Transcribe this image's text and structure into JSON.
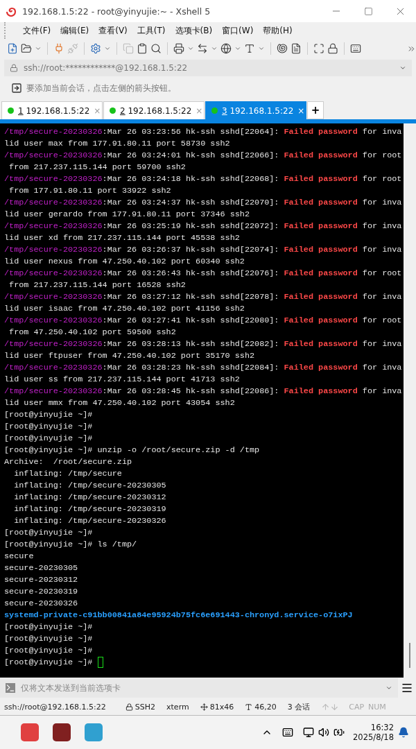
{
  "window": {
    "title": "192.168.1.5:22 - root@yinyujie:~ - Xshell 5"
  },
  "menu": [
    {
      "label": "文件(F)"
    },
    {
      "label": "编辑(E)"
    },
    {
      "label": "查看(V)"
    },
    {
      "label": "工具(T)"
    },
    {
      "label": "选项卡(B)"
    },
    {
      "label": "窗口(W)"
    },
    {
      "label": "帮助(H)"
    }
  ],
  "address_bar": {
    "value": "ssh://root:************@192.168.1.5:22"
  },
  "hint_bar": {
    "text": "要添加当前会话，点击左侧的箭头按钮。"
  },
  "tabs": [
    {
      "number": "1",
      "label": "192.168.1.5:22",
      "selected": false,
      "close": "×"
    },
    {
      "number": "2",
      "label": "192.168.1.5:22",
      "selected": false,
      "close": "×"
    },
    {
      "number": "3",
      "label": "192.168.1.5:22",
      "selected": true,
      "close": "×"
    }
  ],
  "new_tab": "+",
  "terminal": {
    "lines": [
      [
        {
          "kind": "path",
          "text": "/tmp/secure-20230326"
        },
        {
          "kind": "plain",
          "text": ":Mar 26 03:23:56 hk-ssh sshd[22064]: "
        },
        {
          "kind": "alert",
          "text": "Failed password"
        },
        {
          "kind": "plain",
          "text": " for inva"
        }
      ],
      [
        {
          "kind": "plain",
          "text": "lid user max from 177.91.80.11 port 58730 ssh2"
        }
      ],
      [
        {
          "kind": "path",
          "text": "/tmp/secure-20230326"
        },
        {
          "kind": "plain",
          "text": ":Mar 26 03:24:01 hk-ssh sshd[22066]: "
        },
        {
          "kind": "alert",
          "text": "Failed password"
        },
        {
          "kind": "plain",
          "text": " for root"
        }
      ],
      [
        {
          "kind": "plain",
          "text": " from 217.237.115.144 port 59700 ssh2"
        }
      ],
      [
        {
          "kind": "path",
          "text": "/tmp/secure-20230326"
        },
        {
          "kind": "plain",
          "text": ":Mar 26 03:24:18 hk-ssh sshd[22068]: "
        },
        {
          "kind": "alert",
          "text": "Failed password"
        },
        {
          "kind": "plain",
          "text": " for root"
        }
      ],
      [
        {
          "kind": "plain",
          "text": " from 177.91.80.11 port 33922 ssh2"
        }
      ],
      [
        {
          "kind": "path",
          "text": "/tmp/secure-20230326"
        },
        {
          "kind": "plain",
          "text": ":Mar 26 03:24:37 hk-ssh sshd[22070]: "
        },
        {
          "kind": "alert",
          "text": "Failed password"
        },
        {
          "kind": "plain",
          "text": " for inva"
        }
      ],
      [
        {
          "kind": "plain",
          "text": "lid user gerardo from 177.91.80.11 port 37346 ssh2"
        }
      ],
      [
        {
          "kind": "path",
          "text": "/tmp/secure-20230326"
        },
        {
          "kind": "plain",
          "text": ":Mar 26 03:25:19 hk-ssh sshd[22072]: "
        },
        {
          "kind": "alert",
          "text": "Failed password"
        },
        {
          "kind": "plain",
          "text": " for inva"
        }
      ],
      [
        {
          "kind": "plain",
          "text": "lid user xd from 217.237.115.144 port 45538 ssh2"
        }
      ],
      [
        {
          "kind": "path",
          "text": "/tmp/secure-20230326"
        },
        {
          "kind": "plain",
          "text": ":Mar 26 03:26:37 hk-ssh sshd[22074]: "
        },
        {
          "kind": "alert",
          "text": "Failed password"
        },
        {
          "kind": "plain",
          "text": " for inva"
        }
      ],
      [
        {
          "kind": "plain",
          "text": "lid user nexus from 47.250.40.102 port 60340 ssh2"
        }
      ],
      [
        {
          "kind": "path",
          "text": "/tmp/secure-20230326"
        },
        {
          "kind": "plain",
          "text": ":Mar 26 03:26:43 hk-ssh sshd[22076]: "
        },
        {
          "kind": "alert",
          "text": "Failed password"
        },
        {
          "kind": "plain",
          "text": " for root"
        }
      ],
      [
        {
          "kind": "plain",
          "text": " from 217.237.115.144 port 16528 ssh2"
        }
      ],
      [
        {
          "kind": "path",
          "text": "/tmp/secure-20230326"
        },
        {
          "kind": "plain",
          "text": ":Mar 26 03:27:12 hk-ssh sshd[22078]: "
        },
        {
          "kind": "alert",
          "text": "Failed password"
        },
        {
          "kind": "plain",
          "text": " for inva"
        }
      ],
      [
        {
          "kind": "plain",
          "text": "lid user isaac from 47.250.40.102 port 41156 ssh2"
        }
      ],
      [
        {
          "kind": "path",
          "text": "/tmp/secure-20230326"
        },
        {
          "kind": "plain",
          "text": ":Mar 26 03:27:41 hk-ssh sshd[22080]: "
        },
        {
          "kind": "alert",
          "text": "Failed password"
        },
        {
          "kind": "plain",
          "text": " for root"
        }
      ],
      [
        {
          "kind": "plain",
          "text": " from 47.250.40.102 port 59500 ssh2"
        }
      ],
      [
        {
          "kind": "path",
          "text": "/tmp/secure-20230326"
        },
        {
          "kind": "plain",
          "text": ":Mar 26 03:28:13 hk-ssh sshd[22082]: "
        },
        {
          "kind": "alert",
          "text": "Failed password"
        },
        {
          "kind": "plain",
          "text": " for inva"
        }
      ],
      [
        {
          "kind": "plain",
          "text": "lid user ftpuser from 47.250.40.102 port 35170 ssh2"
        }
      ],
      [
        {
          "kind": "path",
          "text": "/tmp/secure-20230326"
        },
        {
          "kind": "plain",
          "text": ":Mar 26 03:28:23 hk-ssh sshd[22084]: "
        },
        {
          "kind": "alert",
          "text": "Failed password"
        },
        {
          "kind": "plain",
          "text": " for inva"
        }
      ],
      [
        {
          "kind": "plain",
          "text": "lid user ss from 217.237.115.144 port 41713 ssh2"
        }
      ],
      [
        {
          "kind": "path",
          "text": "/tmp/secure-20230326"
        },
        {
          "kind": "plain",
          "text": ":Mar 26 03:28:45 hk-ssh sshd[22086]: "
        },
        {
          "kind": "alert",
          "text": "Failed password"
        },
        {
          "kind": "plain",
          "text": " for inva"
        }
      ],
      [
        {
          "kind": "plain",
          "text": "lid user mmx from 47.250.40.102 port 43054 ssh2"
        }
      ],
      [
        {
          "kind": "plain",
          "text": "[root@yinyujie ~]#"
        }
      ],
      [
        {
          "kind": "plain",
          "text": "[root@yinyujie ~]#"
        }
      ],
      [
        {
          "kind": "plain",
          "text": "[root@yinyujie ~]#"
        }
      ],
      [
        {
          "kind": "plain",
          "text": "[root@yinyujie ~]# unzip -o /root/secure.zip -d /tmp"
        }
      ],
      [
        {
          "kind": "plain",
          "text": "Archive:  /root/secure.zip"
        }
      ],
      [
        {
          "kind": "plain",
          "text": "  inflating: /tmp/secure"
        }
      ],
      [
        {
          "kind": "plain",
          "text": "  inflating: /tmp/secure-20230305"
        }
      ],
      [
        {
          "kind": "plain",
          "text": "  inflating: /tmp/secure-20230312"
        }
      ],
      [
        {
          "kind": "plain",
          "text": "  inflating: /tmp/secure-20230319"
        }
      ],
      [
        {
          "kind": "plain",
          "text": "  inflating: /tmp/secure-20230326"
        }
      ],
      [
        {
          "kind": "plain",
          "text": "[root@yinyujie ~]#"
        }
      ],
      [
        {
          "kind": "plain",
          "text": "[root@yinyujie ~]# ls /tmp/"
        }
      ],
      [
        {
          "kind": "plain",
          "text": "secure"
        }
      ],
      [
        {
          "kind": "plain",
          "text": "secure-20230305"
        }
      ],
      [
        {
          "kind": "plain",
          "text": "secure-20230312"
        }
      ],
      [
        {
          "kind": "plain",
          "text": "secure-20230319"
        }
      ],
      [
        {
          "kind": "plain",
          "text": "secure-20230326"
        }
      ],
      [
        {
          "kind": "dir",
          "text": "systemd-private-c91bb00841a84e95924b75fc6e691443-chronyd.service-o7ixPJ"
        }
      ],
      [
        {
          "kind": "plain",
          "text": "[root@yinyujie ~]#"
        }
      ],
      [
        {
          "kind": "plain",
          "text": "[root@yinyujie ~]#"
        }
      ],
      [
        {
          "kind": "plain",
          "text": "[root@yinyujie ~]#"
        }
      ],
      [
        {
          "kind": "plain",
          "text": "[root@yinyujie ~]# "
        },
        {
          "kind": "cursor"
        }
      ]
    ]
  },
  "send_bar": {
    "placeholder": "仅将文本发送到当前选项卡"
  },
  "status_bar": {
    "connection": "ssh://root@192.168.1.5:22",
    "protocol": "SSH2",
    "terminal": "xterm",
    "size": "81x46",
    "cursor": "46,20",
    "sessions": "3 会话",
    "caps": "CAP",
    "num": "NUM"
  },
  "taskbar": {
    "time": "16:32",
    "date": "2025/8/18"
  }
}
